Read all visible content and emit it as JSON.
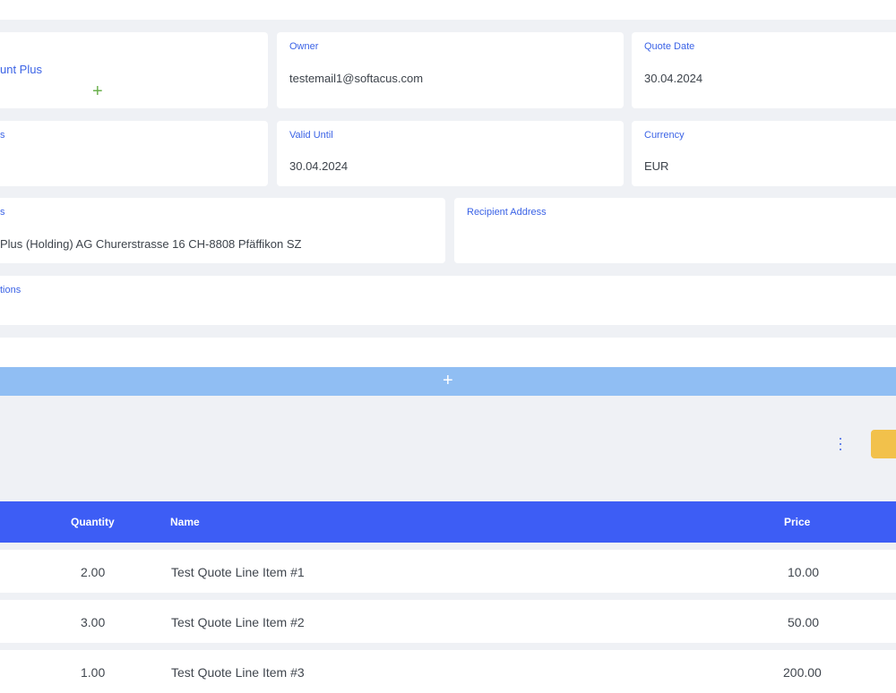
{
  "fields": {
    "account": {
      "label": "",
      "value": "unt Plus"
    },
    "owner": {
      "label": "Owner",
      "value": "testemail1@softacus.com"
    },
    "quote_date": {
      "label": "Quote Date",
      "value": "30.04.2024"
    },
    "status": {
      "label": "s",
      "value": ""
    },
    "valid_until": {
      "label": "Valid Until",
      "value": "30.04.2024"
    },
    "currency": {
      "label": "Currency",
      "value": "EUR"
    },
    "address": {
      "label": "s",
      "value": "Plus (Holding) AG Churerstrasse 16 CH-8808 Pfäffikon SZ"
    },
    "recipient_address": {
      "label": "Recipient Address",
      "value": ""
    },
    "conditions": {
      "label": "tions",
      "value": ""
    }
  },
  "icons": {
    "add_account": "plus-icon",
    "add_line": "plus-icon",
    "more": "kebab-menu-icon"
  },
  "colors": {
    "accent": "#3b63e6",
    "table_header": "#3d5df5",
    "add_bar": "#90bef3",
    "action_button": "#f2c14b",
    "plus_green": "#6ab04c"
  },
  "table": {
    "columns": [
      "Quantity",
      "Name",
      "Price"
    ],
    "rows": [
      {
        "quantity": "2.00",
        "name": "Test Quote Line Item #1",
        "price": "10.00"
      },
      {
        "quantity": "3.00",
        "name": "Test Quote Line Item #2",
        "price": "50.00"
      },
      {
        "quantity": "1.00",
        "name": "Test Quote Line Item #3",
        "price": "200.00"
      }
    ]
  }
}
